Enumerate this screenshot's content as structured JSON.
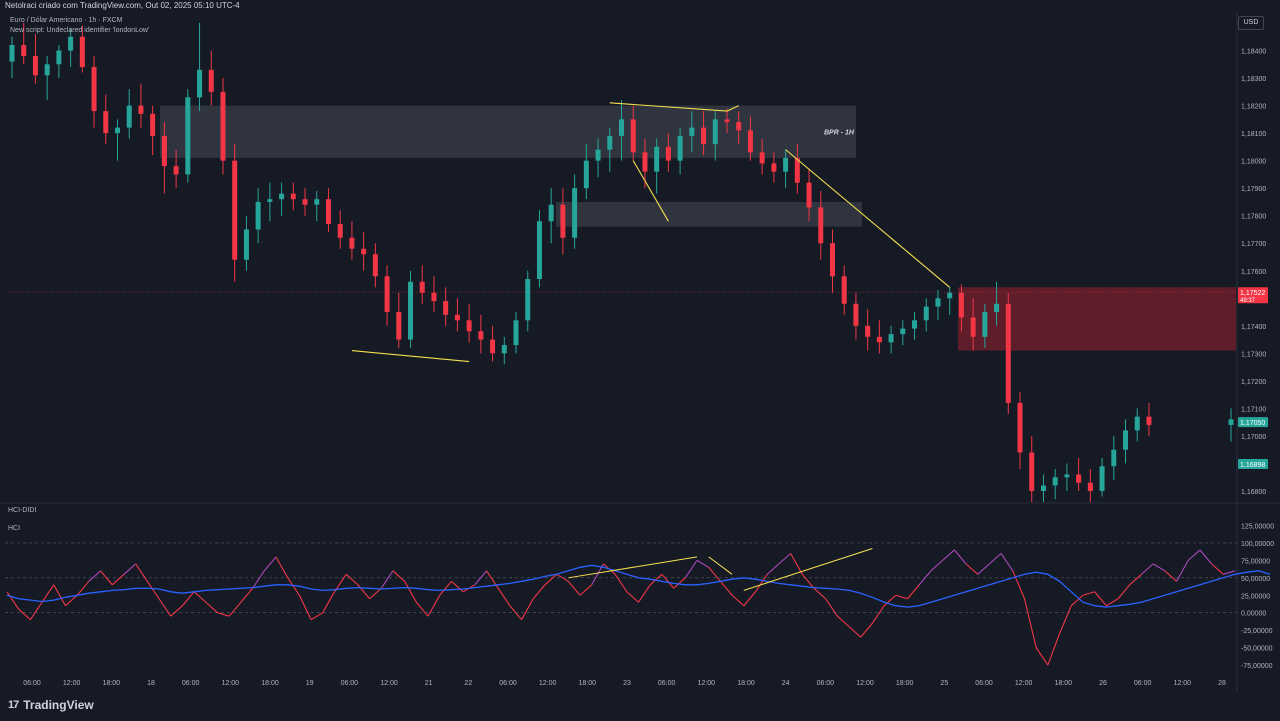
{
  "header": {
    "text": "Netolraci criado com TradingView.com, Out 02, 2025 05:10 UTC-4"
  },
  "legend": {
    "line1": "Euro / Dólar Americano · 1h · FXCM",
    "line2": "New script: Undeclared identifier 'londonLow'"
  },
  "currency_button": "USD",
  "indicator": {
    "pane_label": "HCI-DIDI",
    "sub_label": "HCI"
  },
  "logo": {
    "mark": "17",
    "text": "TradingView"
  },
  "colors": {
    "background": "#161a25",
    "bull": "#26a69a",
    "bear": "#f23645",
    "trendline": "#f5e050",
    "zone_gray": "#3a3d47",
    "zone_red": "#6b1e2a",
    "hci_line": "#2962ff"
  },
  "chart_data": [
    {
      "type": "candlestick",
      "title": "Euro / Dólar Americano · 1h · FXCM",
      "y_ticks": [
        "1,18400",
        "1,18300",
        "1,18200",
        "1,18100",
        "1,18000",
        "1,17900",
        "1,17800",
        "1,17700",
        "1,17600",
        "1,17400",
        "1,17300",
        "1,17200",
        "1,17100",
        "1,17000",
        "1,16800"
      ],
      "ylim": [
        1.1676,
        1.1854
      ],
      "x_ticks": [
        "06:00",
        "12:00",
        "18:00",
        "18",
        "06:00",
        "12:00",
        "18:00",
        "19",
        "06:00",
        "12:00",
        "21",
        "22",
        "06:00",
        "12:00",
        "18:00",
        "23",
        "06:00",
        "12:00",
        "18:00",
        "24",
        "06:00",
        "12:00",
        "18:00",
        "25",
        "06:00",
        "12:00",
        "18:00",
        "26",
        "06:00",
        "12:00",
        "28"
      ],
      "price_labels": [
        {
          "value": "1,17522",
          "sub": "49:37",
          "color": "#f23645"
        },
        {
          "value": "1,17050",
          "color": "#26a69a"
        },
        {
          "value": "1,16898",
          "color": "#26a69a"
        }
      ],
      "annotations": [
        "BPR - 1H"
      ],
      "zones": [
        {
          "name": "BPR - 1H",
          "from": 1.1801,
          "to": 1.182,
          "color": "gray"
        },
        {
          "from": 1.1776,
          "to": 1.1785,
          "color": "gray"
        },
        {
          "from": 1.1731,
          "to": 1.1754,
          "color": "red"
        }
      ],
      "series": [
        {
          "bars": [
            [
              1.1836,
              1.1845,
              1.183,
              1.1842
            ],
            [
              1.1842,
              1.185,
              1.1835,
              1.1838
            ],
            [
              1.1838,
              1.1846,
              1.1828,
              1.1831
            ],
            [
              1.1831,
              1.1838,
              1.1822,
              1.1835
            ],
            [
              1.1835,
              1.1842,
              1.183,
              1.184
            ],
            [
              1.184,
              1.1848,
              1.1834,
              1.1845
            ],
            [
              1.1845,
              1.1849,
              1.1832,
              1.1834
            ],
            [
              1.1834,
              1.1838,
              1.1812,
              1.1818
            ],
            [
              1.1818,
              1.1824,
              1.1806,
              1.181
            ],
            [
              1.181,
              1.1815,
              1.18,
              1.1812
            ],
            [
              1.1812,
              1.1826,
              1.1808,
              1.182
            ],
            [
              1.182,
              1.1828,
              1.1812,
              1.1817
            ],
            [
              1.1817,
              1.182,
              1.1802,
              1.1809
            ],
            [
              1.1809,
              1.1814,
              1.1788,
              1.1798
            ],
            [
              1.1798,
              1.1804,
              1.179,
              1.1795
            ],
            [
              1.1795,
              1.1826,
              1.1792,
              1.1823
            ],
            [
              1.1823,
              1.185,
              1.1818,
              1.1833
            ],
            [
              1.1833,
              1.184,
              1.182,
              1.1825
            ],
            [
              1.1825,
              1.183,
              1.1795,
              1.18
            ],
            [
              1.18,
              1.1806,
              1.1756,
              1.1764
            ],
            [
              1.1764,
              1.178,
              1.176,
              1.1775
            ],
            [
              1.1775,
              1.179,
              1.177,
              1.1785
            ],
            [
              1.1785,
              1.1792,
              1.1778,
              1.1786
            ],
            [
              1.1786,
              1.1792,
              1.178,
              1.1788
            ],
            [
              1.1788,
              1.1792,
              1.1782,
              1.1786
            ],
            [
              1.1786,
              1.179,
              1.178,
              1.1784
            ],
            [
              1.1784,
              1.1789,
              1.1778,
              1.1786
            ],
            [
              1.1786,
              1.179,
              1.1774,
              1.1777
            ],
            [
              1.1777,
              1.1782,
              1.1768,
              1.1772
            ],
            [
              1.1772,
              1.1778,
              1.1764,
              1.1768
            ],
            [
              1.1768,
              1.1774,
              1.176,
              1.1766
            ],
            [
              1.1766,
              1.177,
              1.1754,
              1.1758
            ],
            [
              1.1758,
              1.1762,
              1.174,
              1.1745
            ],
            [
              1.1745,
              1.1752,
              1.1732,
              1.1735
            ],
            [
              1.1735,
              1.176,
              1.1732,
              1.1756
            ],
            [
              1.1756,
              1.1762,
              1.1748,
              1.1752
            ],
            [
              1.1752,
              1.1758,
              1.1745,
              1.1749
            ],
            [
              1.1749,
              1.1754,
              1.174,
              1.1744
            ],
            [
              1.1744,
              1.175,
              1.1738,
              1.1742
            ],
            [
              1.1742,
              1.1748,
              1.1734,
              1.1738
            ],
            [
              1.1738,
              1.1744,
              1.173,
              1.1735
            ],
            [
              1.1735,
              1.174,
              1.1727,
              1.173
            ],
            [
              1.173,
              1.1736,
              1.1726,
              1.1733
            ],
            [
              1.1733,
              1.1745,
              1.173,
              1.1742
            ],
            [
              1.1742,
              1.176,
              1.1738,
              1.1757
            ],
            [
              1.1757,
              1.1782,
              1.1754,
              1.1778
            ],
            [
              1.1778,
              1.179,
              1.177,
              1.1784
            ],
            [
              1.1784,
              1.179,
              1.1766,
              1.1772
            ],
            [
              1.1772,
              1.1795,
              1.1768,
              1.179
            ],
            [
              1.179,
              1.1806,
              1.1786,
              1.18
            ],
            [
              1.18,
              1.1808,
              1.1794,
              1.1804
            ],
            [
              1.1804,
              1.1812,
              1.1796,
              1.1809
            ],
            [
              1.1809,
              1.1822,
              1.18,
              1.1815
            ],
            [
              1.1815,
              1.182,
              1.18,
              1.1803
            ],
            [
              1.1803,
              1.1808,
              1.179,
              1.1796
            ],
            [
              1.1796,
              1.1808,
              1.1788,
              1.1805
            ],
            [
              1.1805,
              1.181,
              1.1796,
              1.18
            ],
            [
              1.18,
              1.1812,
              1.1795,
              1.1809
            ],
            [
              1.1809,
              1.1818,
              1.1803,
              1.1812
            ],
            [
              1.1812,
              1.1818,
              1.1802,
              1.1806
            ],
            [
              1.1806,
              1.1818,
              1.18,
              1.1815
            ],
            [
              1.1815,
              1.1819,
              1.181,
              1.1814
            ],
            [
              1.1814,
              1.1818,
              1.1806,
              1.1811
            ],
            [
              1.1811,
              1.1816,
              1.18,
              1.1803
            ],
            [
              1.1803,
              1.1808,
              1.1795,
              1.1799
            ],
            [
              1.1799,
              1.1803,
              1.1792,
              1.1796
            ]
          ],
          "bars_part2": [
            [
              1.1796,
              1.1804,
              1.179,
              1.1801
            ],
            [
              1.1801,
              1.1806,
              1.1788,
              1.1792
            ],
            [
              1.1792,
              1.1797,
              1.1778,
              1.1783
            ],
            [
              1.1783,
              1.1789,
              1.1764,
              1.177
            ],
            [
              1.177,
              1.1775,
              1.1752,
              1.1758
            ],
            [
              1.1758,
              1.1762,
              1.1744,
              1.1748
            ],
            [
              1.1748,
              1.1752,
              1.1735,
              1.174
            ],
            [
              1.174,
              1.1746,
              1.1731,
              1.1736
            ],
            [
              1.1736,
              1.1742,
              1.173,
              1.1734
            ],
            [
              1.1734,
              1.174,
              1.173,
              1.1737
            ],
            [
              1.1737,
              1.1742,
              1.1733,
              1.1739
            ],
            [
              1.1739,
              1.1745,
              1.1735,
              1.1742
            ],
            [
              1.1742,
              1.175,
              1.1738,
              1.1747
            ],
            [
              1.1747,
              1.1753,
              1.1742,
              1.175
            ],
            [
              1.175,
              1.1754,
              1.1744,
              1.1752
            ],
            [
              1.1752,
              1.1755,
              1.1738,
              1.1743
            ],
            [
              1.1743,
              1.175,
              1.1731,
              1.1736
            ],
            [
              1.1736,
              1.1748,
              1.1732,
              1.1745
            ],
            [
              1.1745,
              1.1756,
              1.174,
              1.1748
            ],
            [
              1.1748,
              1.1752,
              1.1708,
              1.1712
            ],
            [
              1.1712,
              1.1716,
              1.1688,
              1.1694
            ],
            [
              1.1694,
              1.17,
              1.1676,
              1.168
            ],
            [
              1.168,
              1.1686,
              1.1676,
              1.1682
            ],
            [
              1.1682,
              1.1688,
              1.1677,
              1.1685
            ],
            [
              1.1685,
              1.169,
              1.168,
              1.1686
            ],
            [
              1.1686,
              1.1692,
              1.168,
              1.1683
            ],
            [
              1.1683,
              1.1688,
              1.1676,
              1.168
            ],
            [
              1.168,
              1.1692,
              1.1678,
              1.1689
            ],
            [
              1.1689,
              1.17,
              1.1684,
              1.1695
            ],
            [
              1.1695,
              1.1706,
              1.169,
              1.1702
            ],
            [
              1.1702,
              1.171,
              1.1698,
              1.1707
            ],
            [
              1.1707,
              1.1712,
              1.17,
              1.1704
            ],
            [
              1.1704,
              1.171,
              1.1698,
              1.1706
            ]
          ]
        }
      ]
    },
    {
      "type": "line",
      "title": "HCI",
      "y_ticks": [
        "125,00000",
        "100,00000",
        "75,00000",
        "50,00000",
        "25,00000",
        "0,00000",
        "-25,00000",
        "-50,00000",
        "-75,00000"
      ],
      "ylim": [
        -85,
        130
      ],
      "levels": [
        100,
        50,
        0
      ],
      "series": [
        {
          "values": [
            30,
            5,
            -10,
            15,
            40,
            10,
            25,
            45,
            60,
            40,
            55,
            70,
            45,
            20,
            -5,
            10,
            30,
            15,
            0,
            -5,
            15,
            35,
            60,
            80,
            50,
            25,
            -10,
            0,
            30,
            55,
            40,
            20,
            35,
            60,
            45,
            15,
            -5,
            25,
            45,
            30,
            40,
            60,
            35,
            10,
            -10,
            20,
            40,
            55,
            45,
            25,
            40,
            70,
            55,
            30,
            15,
            40,
            55,
            35,
            50,
            75,
            65,
            45,
            25,
            10,
            30,
            55,
            70,
            85,
            55,
            35,
            20,
            -5,
            -20,
            -35,
            -15,
            10,
            25,
            20,
            40,
            60,
            75,
            90,
            70,
            55,
            70,
            85,
            60,
            20,
            -50,
            -75,
            -30,
            10,
            25,
            30,
            10,
            20,
            40,
            55,
            70,
            60,
            45,
            75,
            90,
            70,
            55,
            60
          ],
          "colors": "mixed"
        },
        {
          "values": [
            25,
            20,
            18,
            16,
            18,
            22,
            25,
            28,
            30,
            32,
            33,
            35,
            35,
            34,
            30,
            28,
            30,
            32,
            33,
            34,
            35,
            36,
            38,
            40,
            40,
            38,
            34,
            32,
            33,
            35,
            36,
            35,
            34,
            35,
            36,
            35,
            33,
            32,
            33,
            34,
            36,
            38,
            40,
            42,
            45,
            48,
            52,
            55,
            60,
            65,
            68,
            65,
            60,
            55,
            50,
            48,
            45,
            42,
            40,
            40,
            42,
            45,
            48,
            50,
            48,
            45,
            42,
            40,
            38,
            36,
            35,
            34,
            32,
            28,
            22,
            15,
            10,
            8,
            10,
            15,
            20,
            25,
            30,
            35,
            40,
            45,
            50,
            55,
            58,
            55,
            45,
            30,
            15,
            10,
            8,
            10,
            12,
            15,
            20,
            25,
            30,
            35,
            40,
            45,
            50,
            55,
            58,
            60,
            55
          ]
        }
      ]
    }
  ]
}
